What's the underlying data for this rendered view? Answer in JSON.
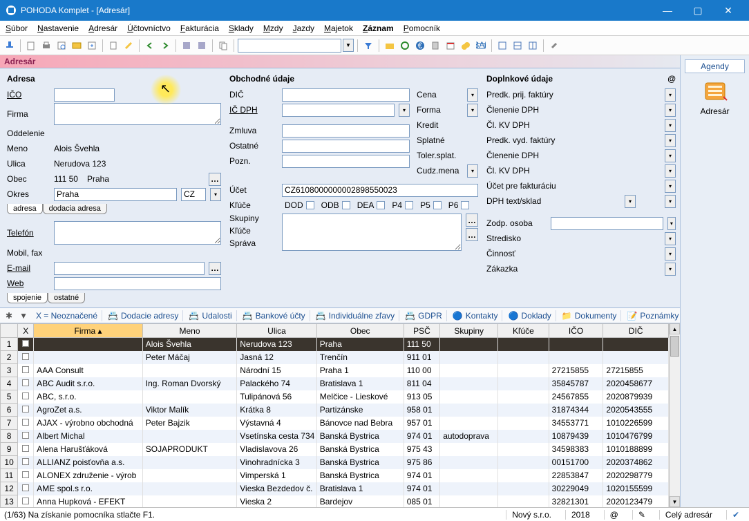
{
  "window": {
    "title": "POHODA Komplet - [Adresár]"
  },
  "menu": {
    "items": [
      "Súbor",
      "Nastavenie",
      "Adresár",
      "Účtovníctvo",
      "Fakturácia",
      "Sklady",
      "Mzdy",
      "Jazdy",
      "Majetok",
      "Záznam",
      "Pomocník"
    ]
  },
  "agenda_band": "Adresár",
  "section_address": "Adresa",
  "labels": {
    "ico": "IČO",
    "firma": "Firma",
    "oddelenie": "Oddelenie",
    "meno": "Meno",
    "ulica": "Ulica",
    "obec": "Obec",
    "okres": "Okres",
    "telefon": "Telefón",
    "mobilfax": "Mobil, fax",
    "email": "E-mail",
    "web": "Web",
    "tab_adresa": "adresa",
    "tab_dodacia": "dodacia adresa",
    "tab_spojenie": "spojenie",
    "tab_ostatne": "ostatné"
  },
  "values": {
    "meno": "Alois Švehla",
    "ulica": "Nerudova 123",
    "psc": "111 50",
    "obec": "Praha",
    "okres": "Praha",
    "country": "CZ",
    "ucet": "CZ6108000000002898550023"
  },
  "section_business": "Obchodné údaje",
  "biz_labels": {
    "dic": "DIČ",
    "icdph": "IČ DPH",
    "zmluva": "Zmluva",
    "ostatne": "Ostatné",
    "pozn": "Pozn.",
    "ucet": "Účet",
    "kluce": "Kľúče",
    "skupiny": "Skupiny",
    "kluce2": "Kľúče",
    "sprava": "Správa",
    "cena": "Cena",
    "forma": "Forma",
    "kredit": "Kredit",
    "splatne": "Splatné",
    "tolersplat": "Toler.splat.",
    "cudzmena": "Cudz.mena"
  },
  "keys": [
    "DOD",
    "ODB",
    "DEA",
    "P4",
    "P5",
    "P6"
  ],
  "section_extra": "Doplnkové údaje",
  "extra_labels": {
    "predk_prij": "Predk. prij. faktúry",
    "clenenie_dph1": "Členenie DPH",
    "cl_kv_dph1": "Čl. KV DPH",
    "predk_vyd": "Predk. vyd. faktúry",
    "clenenie_dph2": "Členenie DPH",
    "cl_kv_dph2": "Čl. KV DPH",
    "ucet_fakt": "Účet pre fakturáciu",
    "dph_sklad": "DPH text/sklad",
    "zodp_osoba": "Zodp. osoba",
    "stredisko": "Stredisko",
    "cinnost": "Činnosť",
    "zakazka": "Zákazka"
  },
  "grid_tabs": {
    "xeq": "X = Neoznačené",
    "tabs": [
      "Dodacie adresy",
      "Udalosti",
      "Bankové účty",
      "Individuálne zľavy",
      "GDPR",
      "Kontakty",
      "Doklady",
      "Dokumenty",
      "Poznámky"
    ]
  },
  "grid": {
    "columns": [
      "",
      "X",
      "Firma",
      "Meno",
      "Ulica",
      "Obec",
      "PSČ",
      "Skupiny",
      "Kľúče",
      "IČO",
      "DIČ"
    ],
    "sorted_col": 2,
    "rows": [
      {
        "n": "1",
        "x": "",
        "firma": "",
        "meno": "Alois Švehla",
        "ulica": "Nerudova 123",
        "obec": "Praha",
        "psc": "111 50",
        "sk": "",
        "kl": "",
        "ico": "",
        "dic": "",
        "sel": true
      },
      {
        "n": "2",
        "x": "",
        "firma": "",
        "meno": "Peter  Máčaj",
        "ulica": "Jasná 12",
        "obec": "Trenčín",
        "psc": "911 01",
        "sk": "",
        "kl": "",
        "ico": "",
        "dic": ""
      },
      {
        "n": "3",
        "x": "",
        "firma": "AAA Consult",
        "meno": "",
        "ulica": "Národní 15",
        "obec": "Praha 1",
        "psc": "110 00",
        "sk": "",
        "kl": "",
        "ico": "27215855",
        "dic": "27215855"
      },
      {
        "n": "4",
        "x": "",
        "firma": "ABC Audit s.r.o.",
        "meno": "Ing. Roman Dvorský",
        "ulica": "Palackého 74",
        "obec": "Bratislava 1",
        "psc": "811 04",
        "sk": "",
        "kl": "",
        "ico": "35845787",
        "dic": "2020458677"
      },
      {
        "n": "5",
        "x": "",
        "firma": "ABC, s.r.o.",
        "meno": "",
        "ulica": "Tulipánová 56",
        "obec": "Melčice - Lieskové",
        "psc": "913 05",
        "sk": "",
        "kl": "",
        "ico": "24567855",
        "dic": "2020879939"
      },
      {
        "n": "6",
        "x": "",
        "firma": "AgroZet a.s.",
        "meno": "Viktor Malík",
        "ulica": "Krátka 8",
        "obec": "Partizánske",
        "psc": "958 01",
        "sk": "",
        "kl": "",
        "ico": "31874344",
        "dic": "2020543555"
      },
      {
        "n": "7",
        "x": "",
        "firma": "AJAX - výrobno obchodná",
        "meno": "Peter Bajzik",
        "ulica": "Výstavná 4",
        "obec": "Bánovce nad Bebra",
        "psc": "957 01",
        "sk": "",
        "kl": "",
        "ico": "34553771",
        "dic": "1010226599"
      },
      {
        "n": "8",
        "x": "",
        "firma": "Albert Michal",
        "meno": "",
        "ulica": "Vsetínska cesta 734",
        "obec": "Banská Bystrica",
        "psc": "974 01",
        "sk": "autodoprava",
        "kl": "",
        "ico": "10879439",
        "dic": "1010476799"
      },
      {
        "n": "9",
        "x": "",
        "firma": "Alena Harušťáková",
        "meno": "SOJAPRODUKT",
        "ulica": "Vladislavova 26",
        "obec": "Banská Bystrica",
        "psc": "975 43",
        "sk": "",
        "kl": "",
        "ico": "34598383",
        "dic": "1010188899"
      },
      {
        "n": "10",
        "x": "",
        "firma": "ALLIANZ poisťovňa a.s.",
        "meno": "",
        "ulica": "Vinohradnícka 3",
        "obec": "Banská Bystrica",
        "psc": "975 86",
        "sk": "",
        "kl": "",
        "ico": "00151700",
        "dic": "2020374862"
      },
      {
        "n": "11",
        "x": "",
        "firma": "ALONEX združenie - výrob",
        "meno": "",
        "ulica": "Vimperská 1",
        "obec": "Banská Bystrica",
        "psc": "974 01",
        "sk": "",
        "kl": "",
        "ico": "22853847",
        "dic": "2020298779"
      },
      {
        "n": "12",
        "x": "",
        "firma": "AME spol.s r.o.",
        "meno": "",
        "ulica": "Vieska Bezdedov č.",
        "obec": "Bratislava 1",
        "psc": "974 01",
        "sk": "",
        "kl": "",
        "ico": "30229049",
        "dic": "1020155599"
      },
      {
        "n": "13",
        "x": "",
        "firma": "Anna Hupková -  EFEKT",
        "meno": "",
        "ulica": "Vieska 2",
        "obec": "Bardejov",
        "psc": "085 01",
        "sk": "",
        "kl": "",
        "ico": "32821301",
        "dic": "2020123479"
      }
    ]
  },
  "status": {
    "left": "(1/63) Na získanie pomocníka stlačte F1.",
    "company": "Nový s.r.o.",
    "year": "2018",
    "right": "Celý adresár"
  },
  "side": {
    "head": "Agendy",
    "label": "Adresár"
  }
}
